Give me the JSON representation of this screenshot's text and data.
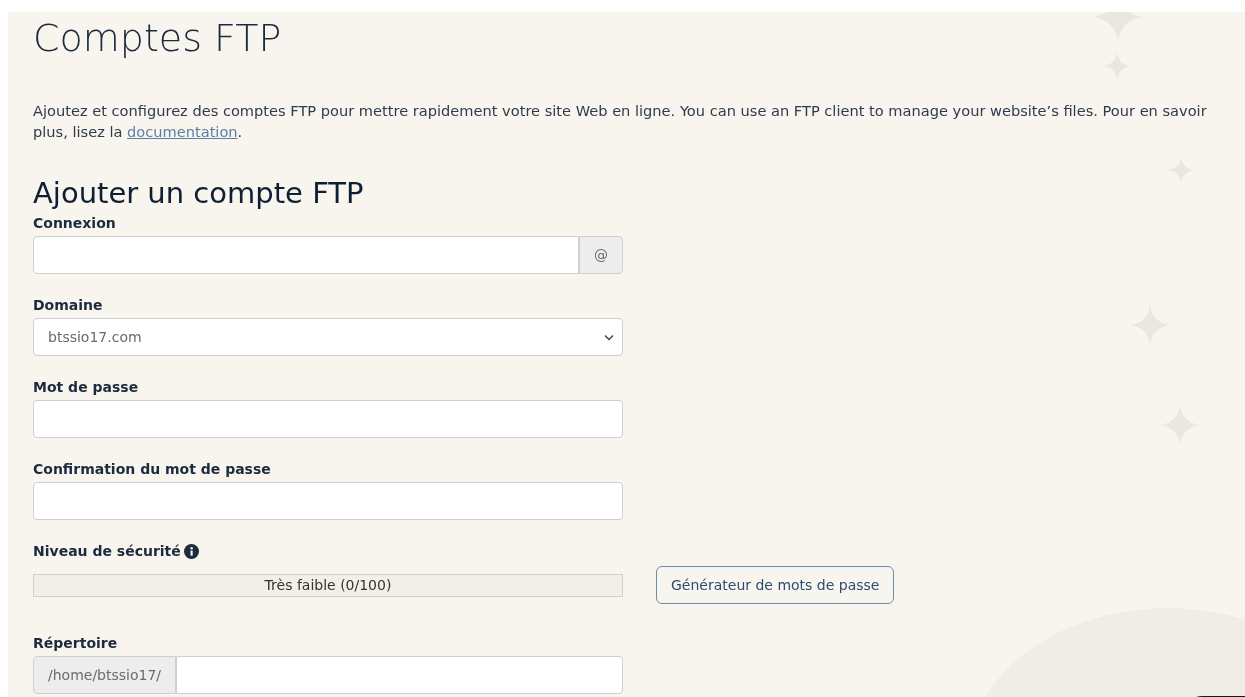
{
  "page_title": "Comptes FTP",
  "intro": {
    "text": "Ajoutez et configurez des comptes FTP pour mettre rapidement votre site Web en ligne. You can use an FTP client to manage your website’s files. Pour en savoir plus, lisez la",
    "link": "documentation",
    "after": "."
  },
  "form": {
    "title": "Ajouter un compte FTP",
    "fields": [
      {
        "kind": "addon-right",
        "label": "Connexion",
        "addon": "@"
      },
      {
        "kind": "select",
        "label": "Domaine",
        "value": "btssio17.com"
      },
      {
        "kind": "input",
        "label": "Mot de passe"
      },
      {
        "kind": "input",
        "label": "Confirmation du mot de passe"
      },
      {
        "kind": "meter",
        "label": "Niveau de sécurité",
        "info": true,
        "level": 0,
        "reading": "Très faible (0/100)",
        "button": "Générateur de mots de passe"
      },
      {
        "kind": "addon-left",
        "label": "Répertoire",
        "addon": "/home/btssio17/"
      }
    ]
  }
}
